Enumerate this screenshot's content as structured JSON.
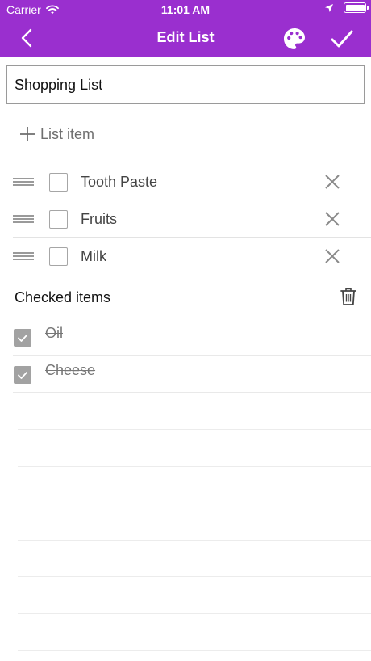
{
  "status_bar": {
    "carrier": "Carrier",
    "time": "11:01 AM"
  },
  "nav": {
    "title": "Edit List",
    "back_icon": "chevron-left-icon",
    "palette_icon": "palette-icon",
    "done_icon": "checkmark-icon"
  },
  "title_field": {
    "value": "Shopping List"
  },
  "add_item": {
    "label": "List item",
    "icon": "plus-icon"
  },
  "items": [
    {
      "text": "Tooth Paste",
      "checked": false
    },
    {
      "text": "Fruits",
      "checked": false
    },
    {
      "text": "Milk",
      "checked": false
    }
  ],
  "checked_section": {
    "title": "Checked items",
    "delete_icon": "trash-icon",
    "items": [
      {
        "text": "Oil",
        "checked": true
      },
      {
        "text": "Cheese",
        "checked": true
      }
    ]
  },
  "colors": {
    "accent": "#9a2fcf",
    "checkbox_checked": "#a2a2a2"
  }
}
